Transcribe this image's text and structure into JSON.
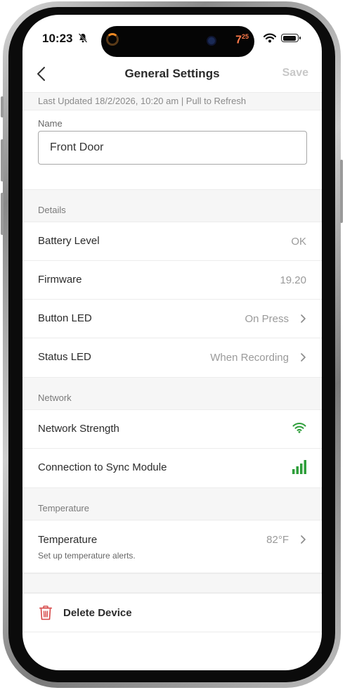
{
  "status_bar": {
    "time": "10:23",
    "island_number": "7",
    "island_number_sup": "25"
  },
  "nav": {
    "title": "General Settings",
    "save_label": "Save"
  },
  "last_updated": "Last Updated 18/2/2026, 10:20 am | Pull to Refresh",
  "name": {
    "label": "Name",
    "value": "Front Door"
  },
  "details": {
    "header": "Details",
    "rows": [
      {
        "label": "Battery Level",
        "value": "OK"
      },
      {
        "label": "Firmware",
        "value": "19.20"
      },
      {
        "label": "Button LED",
        "value": "On Press"
      },
      {
        "label": "Status LED",
        "value": "When Recording"
      }
    ]
  },
  "network": {
    "header": "Network",
    "rows": [
      {
        "label": "Network Strength",
        "icon": "wifi-strength-icon"
      },
      {
        "label": "Connection to Sync Module",
        "icon": "signal-bars-icon"
      }
    ]
  },
  "temperature": {
    "header": "Temperature",
    "label": "Temperature",
    "value": "82°F",
    "sub": "Set up temperature alerts."
  },
  "delete": {
    "label": "Delete Device"
  },
  "colors": {
    "accent_green": "#2e9e3a",
    "delete_red": "#d64545",
    "save_disabled": "#c8c8c8"
  }
}
